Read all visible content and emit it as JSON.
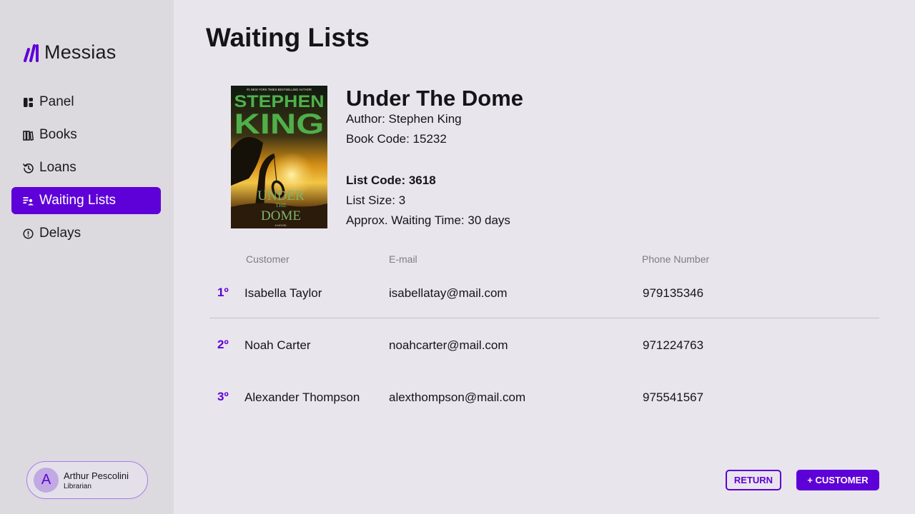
{
  "app": {
    "name": "Messias"
  },
  "sidebar": {
    "items": [
      {
        "label": "Panel",
        "icon": "dashboard-icon",
        "active": false
      },
      {
        "label": "Books",
        "icon": "books-icon",
        "active": false
      },
      {
        "label": "Loans",
        "icon": "history-icon",
        "active": false
      },
      {
        "label": "Waiting Lists",
        "icon": "queue-icon",
        "active": true
      },
      {
        "label": "Delays",
        "icon": "alert-circle-icon",
        "active": false
      }
    ]
  },
  "user": {
    "initial": "A",
    "name": "Arthur Pescolini",
    "role": "Librarian"
  },
  "page": {
    "title": "Waiting Lists"
  },
  "book": {
    "cover": {
      "banner": "#1 NEW YORK TIMES BESTSELLING AUTHOR",
      "author_first": "STEPHEN",
      "author_last": "KING",
      "title_line1": "UNDER",
      "title_line2": "THE",
      "title_line3": "DOME",
      "footer": "A NOVEL"
    },
    "title": "Under The Dome",
    "author": "Author: Stephen King",
    "code": "Book Code: 15232",
    "list_code": "List Code: 3618",
    "list_size": "List Size: 3",
    "waiting_time": "Approx. Waiting Time: 30 days"
  },
  "table": {
    "headers": {
      "customer": "Customer",
      "email": "E-mail",
      "phone": "Phone Number"
    },
    "rows": [
      {
        "rank": "1º",
        "customer": "Isabella Taylor",
        "email": "isabellatay@mail.com",
        "phone": "979135346"
      },
      {
        "rank": "2º",
        "customer": "Noah Carter",
        "email": "noahcarter@mail.com",
        "phone": "971224763"
      },
      {
        "rank": "3º",
        "customer": "Alexander Thompson",
        "email": "alexthompson@mail.com",
        "phone": "975541567"
      }
    ]
  },
  "actions": {
    "return_label": "RETURN",
    "add_customer_label": "+ CUSTOMER"
  },
  "colors": {
    "accent": "#5e00d8",
    "sidebar_bg": "#dcd9df",
    "page_bg": "#e8e5ec"
  }
}
